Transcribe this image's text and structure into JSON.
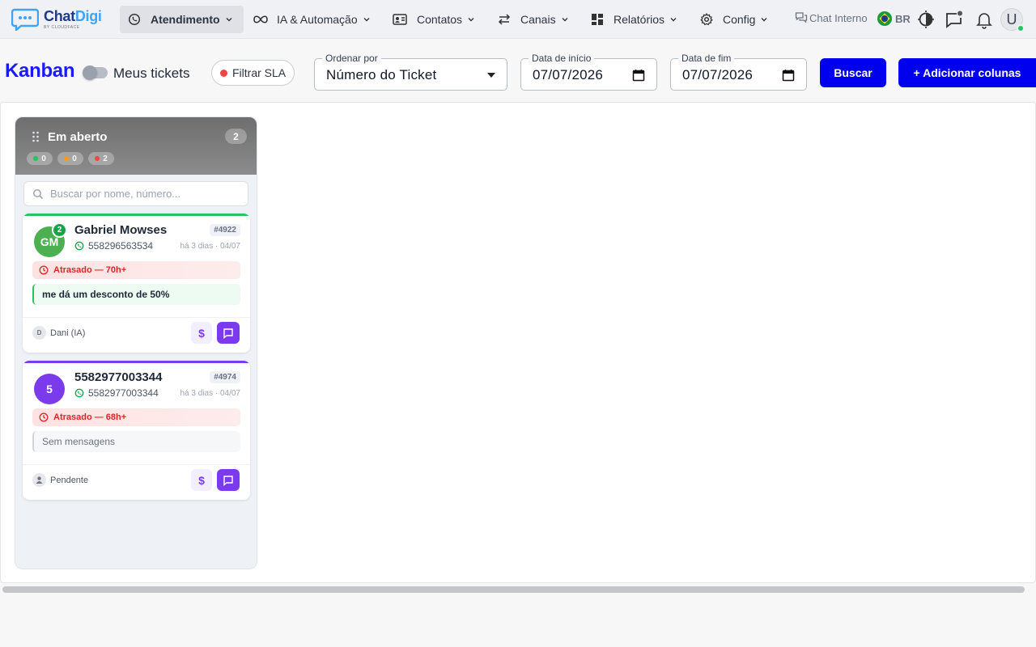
{
  "brand": {
    "name_a": "Chat",
    "name_b": "Digi",
    "tagline": "BY CLOUDFACE"
  },
  "nav": {
    "items": [
      {
        "label": "Atendimento",
        "icon": "whatsapp-icon",
        "active": true
      },
      {
        "label": "IA & Automação",
        "icon": "infinity-icon"
      },
      {
        "label": "Contatos",
        "icon": "contact-card-icon"
      },
      {
        "label": "Canais",
        "icon": "arrows-icon"
      },
      {
        "label": "Relatórios",
        "icon": "dashboard-icon"
      },
      {
        "label": "Config",
        "icon": "gear-icon"
      }
    ],
    "chat_interno": "Chat Interno",
    "language": "BR",
    "user_initial": "U"
  },
  "toolbar": {
    "title": "Kanban",
    "my_tickets_label": "Meus tickets",
    "sla_filter_label": "Filtrar SLA",
    "sort_legend": "Ordenar por",
    "sort_value": "Número do Ticket",
    "start_legend": "Data de início",
    "start_value": "07/07/2026",
    "end_legend": "Data de fim",
    "end_value": "07/07/2026",
    "search_button": "Buscar",
    "add_columns_button": "+ Adicionar colunas"
  },
  "column": {
    "title": "Em aberto",
    "count": "2",
    "pills": [
      {
        "value": "0",
        "color": "#22c55e"
      },
      {
        "value": "0",
        "color": "#f59e0b"
      },
      {
        "value": "2",
        "color": "#ef4444"
      }
    ],
    "search_placeholder": "Buscar por nome, número..."
  },
  "cards": [
    {
      "initials": "GM",
      "unread": "2",
      "name": "Gabriel Mowses",
      "ticket_id": "#4922",
      "phone": "558296563534",
      "when": "há 3 dias · 04/07",
      "sla": "Atrasado — 70h+",
      "message": "me dá um desconto de 50%",
      "owner_initial": "D",
      "owner": "Dani (IA)",
      "accent": "#22c55e",
      "avatar_color": "#4caf50"
    },
    {
      "initials": "5",
      "name": "5582977003344",
      "ticket_id": "#4974",
      "phone": "5582977003344",
      "when": "há 3 dias · 04/07",
      "sla": "Atrasado — 68h+",
      "message": "Sem mensagens",
      "owner": "Pendente",
      "accent": "#7c3aed",
      "avatar_color": "#7c3aed"
    }
  ]
}
